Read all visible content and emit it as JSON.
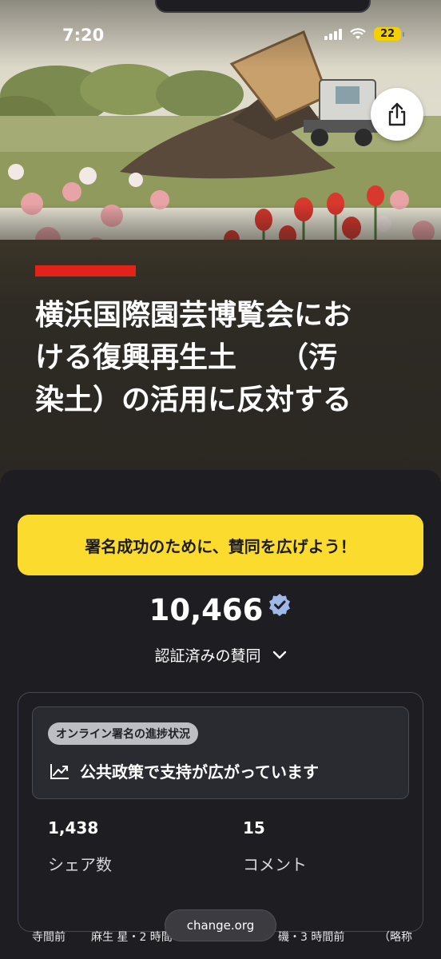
{
  "status_bar": {
    "time": "7:20",
    "battery": "22"
  },
  "petition": {
    "title": "横浜国際園芸博覧会にお\nける復興再生土　　（汚\n染土）の活用に反対する"
  },
  "promo_button": {
    "label": "署名成功のために、賛同を広げよう！"
  },
  "signatures": {
    "count": "10,466",
    "label": "認証済みの賛同"
  },
  "progress": {
    "tag": "オンライン署名の進捗状況",
    "text": "公共政策で支持が広がっています"
  },
  "stats": [
    {
      "value": "1,438",
      "label": "シェア数"
    },
    {
      "value": "15",
      "label": "コメント"
    }
  ],
  "ticker": [
    "寺間前",
    "麻生 星・2 時間",
    "磯・3 時間前",
    "（略称"
  ],
  "url_bar": {
    "text": "change.org"
  },
  "icons": {
    "share": "share-icon",
    "verified": "verified-badge-icon",
    "chevron": "chevron-down-icon",
    "trend": "trending-up-icon",
    "signal": "signal-icon",
    "wifi": "wifi-icon"
  },
  "colors": {
    "accent_red": "#e1231a",
    "promo_yellow": "#fbdb2e",
    "verified_blue": "#9fb8e8",
    "card_bg": "#1d1d22"
  }
}
